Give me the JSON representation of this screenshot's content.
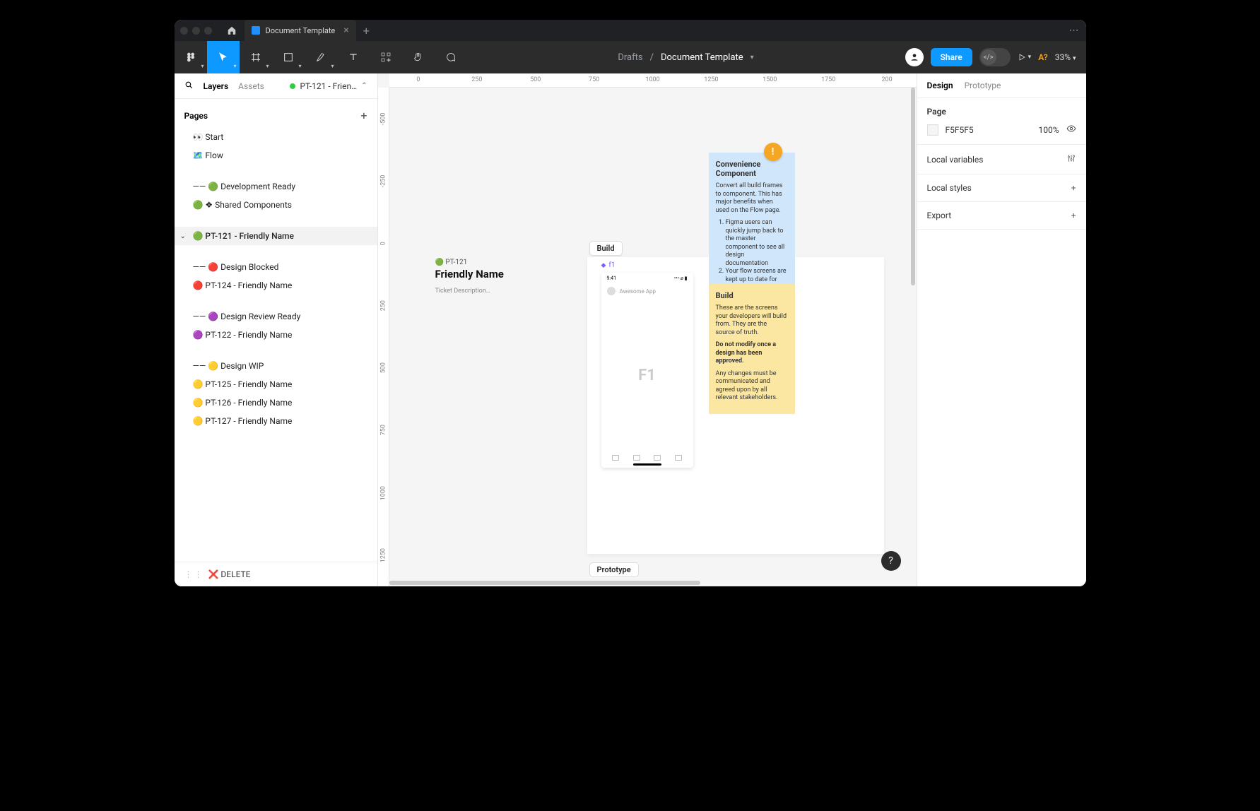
{
  "titlebar": {
    "doc_tab_label": "Document Template"
  },
  "toolbar": {
    "crumb_location": "Drafts",
    "crumb_divider": "/",
    "crumb_name": "Document Template",
    "share_label": "Share",
    "dev_label": "</>",
    "aq_label": "A?",
    "zoom_label": "33%"
  },
  "left_panel": {
    "tab_layers": "Layers",
    "tab_assets": "Assets",
    "current_page_short": "PT-121 - Frien…",
    "pages_header": "Pages",
    "pages": [
      {
        "label": "👀 Start"
      },
      {
        "label": "🗺️ Flow"
      },
      {
        "spacer": true
      },
      {
        "label": "—— 🟢 Development Ready"
      },
      {
        "label": "🟢 ❖ Shared Components"
      },
      {
        "spacer": true
      },
      {
        "label": "🟢 PT-121 - Friendly Name",
        "selected": true,
        "chevron": true
      },
      {
        "spacer": true
      },
      {
        "label": "—— 🔴 Design Blocked"
      },
      {
        "label": "🔴 PT-124 - Friendly Name"
      },
      {
        "spacer": true
      },
      {
        "label": "—— 🟣 Design Review Ready"
      },
      {
        "label": "🟣 PT-122 - Friendly Name"
      },
      {
        "spacer": true
      },
      {
        "label": "—— 🟡 Design WIP"
      },
      {
        "label": "🟡 PT-125 - Friendly Name"
      },
      {
        "label": "🟡 PT-126 - Friendly Name"
      },
      {
        "label": "🟡 PT-127 - Friendly Name"
      }
    ],
    "delete_label": "❌ DELETE"
  },
  "ruler_h": [
    "0",
    "250",
    "500",
    "750",
    "1000",
    "1250",
    "1500",
    "1750",
    "200"
  ],
  "ruler_v": [
    "-500",
    "-250",
    "0",
    "250",
    "500",
    "750",
    "1000",
    "1250"
  ],
  "canvas": {
    "ticket_prefix": "🟢 PT-121",
    "ticket_title": "Friendly Name",
    "ticket_desc": "Ticket Description…",
    "build_label": "Build",
    "proto_label": "Prototype",
    "frame1_name": "f1",
    "frame1_time": "9:41",
    "frame1_app": "Awesome App",
    "frame1_mid": "F1",
    "badge_glyph": "!",
    "blue_card": {
      "title": "Convenience Component",
      "body": "Convert all build frames to component. This has major benefits when used on the Flow page.",
      "li1": "Figma users can quickly jump back to the master component to see all design documentation",
      "li2": "Your flow screens are kept up to date for free"
    },
    "yellow_card": {
      "title": "Build",
      "body1": "These are the screens your developers will build from. They are the source of truth.",
      "body2_bold": "Do not modify once a design has been approved.",
      "body3": "Any changes must be communicated and agreed upon by all relevant stakeholders."
    }
  },
  "right_panel": {
    "tab_design": "Design",
    "tab_prototype": "Prototype",
    "page_header": "Page",
    "fill_hex": "F5F5F5",
    "fill_opacity": "100%",
    "local_vars": "Local variables",
    "local_styles": "Local styles",
    "export": "Export"
  },
  "help_glyph": "?"
}
